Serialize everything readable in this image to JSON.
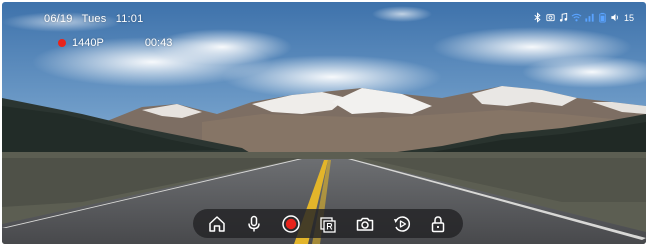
{
  "status_bar": {
    "date": "06/19",
    "day": "Tues",
    "time": "11:01",
    "icons": [
      "bluetooth-icon",
      "media-icon",
      "music-icon",
      "wifi-icon",
      "signal-icon",
      "battery-icon",
      "volume-icon"
    ],
    "volume_level": "15"
  },
  "recording": {
    "resolution": "1440P",
    "elapsed": "00:43",
    "indicator_color": "#e8241c"
  },
  "toolbar": {
    "buttons": [
      "home-icon",
      "microphone-icon",
      "record-icon",
      "rear-camera-icon",
      "camera-icon",
      "playback-icon",
      "lock-icon"
    ],
    "record_color": "#e8241c"
  }
}
